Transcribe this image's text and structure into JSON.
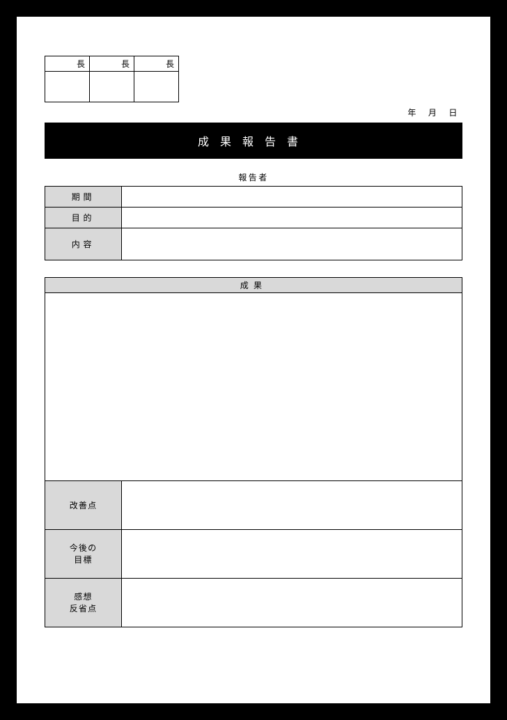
{
  "approval": {
    "headers": [
      "長",
      "長",
      "長"
    ]
  },
  "date": {
    "year": "年",
    "month": "月",
    "day": "日"
  },
  "title": "成果報告書",
  "reporter_label": "報告者",
  "rows": {
    "period": {
      "label": "期間",
      "value": ""
    },
    "purpose": {
      "label": "目的",
      "value": ""
    },
    "content": {
      "label": "内容",
      "value": ""
    }
  },
  "result": {
    "label": "成果",
    "value": ""
  },
  "improve": {
    "label": "改善点",
    "value": ""
  },
  "future": {
    "label1": "今後の",
    "label2": "目標",
    "value": ""
  },
  "thoughts": {
    "label1": "感想",
    "label2": "反省点",
    "value": ""
  }
}
